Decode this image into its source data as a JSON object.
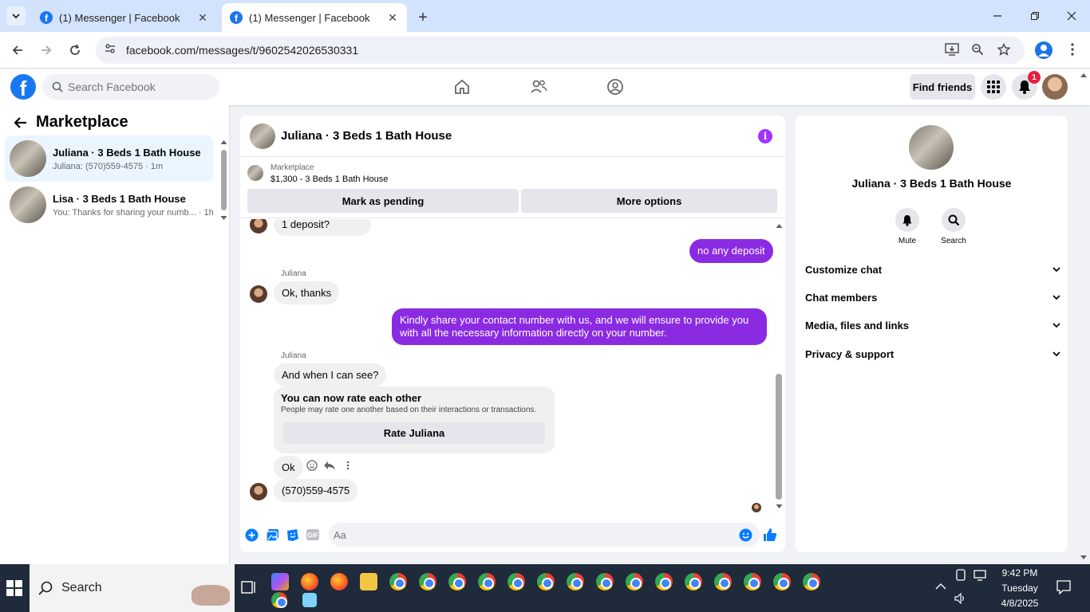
{
  "browser": {
    "tabs": [
      {
        "title": "(1) Messenger | Facebook",
        "active": false
      },
      {
        "title": "(1) Messenger | Facebook",
        "active": true
      }
    ],
    "url": "facebook.com/messages/t/9602542026530331"
  },
  "fb": {
    "logo": "f",
    "search_placeholder": "Search Facebook",
    "find_friends": "Find friends",
    "notification_count": "1"
  },
  "sidebar": {
    "title": "Marketplace",
    "conversations": [
      {
        "name": "Juliana · 3 Beds 1 Bath House",
        "preview": "Juliana: (570)559-4575 · 1m"
      },
      {
        "name": "Lisa · 3 Beds 1 Bath House",
        "preview": "You: Thanks for sharing your numb... · 1h"
      }
    ]
  },
  "chat": {
    "title": "Juliana · 3 Beds 1 Bath House",
    "info_glyph": "i",
    "marketplace": {
      "label": "Marketplace",
      "listing": "$1,300 - 3 Beds 1 Bath House",
      "mark_pending": "Mark as pending",
      "more_options": "More options"
    },
    "messages": {
      "m1": "1 deposit?",
      "m2": "no any deposit",
      "sender1": "Juliana",
      "m3": "Ok, thanks",
      "m4": "Kindly share your contact number with us, and we will ensure to provide you with all the necessary information directly on your number.",
      "sender2": "Juliana",
      "m5": "And when I can see?",
      "m6": "Ok",
      "m7": "(570)559-4575"
    },
    "rate_card": {
      "title": "You can now rate each other",
      "subtitle": "People may rate one another based on their interactions or transactions.",
      "button": "Rate Juliana"
    },
    "composer_placeholder": "Aa"
  },
  "details": {
    "name": "Juliana · 3 Beds 1 Bath House",
    "actions": [
      {
        "label": "Mute"
      },
      {
        "label": "Search"
      }
    ],
    "sections": [
      "Customize chat",
      "Chat members",
      "Media, files and links",
      "Privacy & support"
    ]
  },
  "taskbar": {
    "search": "Search",
    "time": "9:42 PM",
    "day": "Tuesday",
    "date": "4/8/2025"
  },
  "colors": {
    "fb_blue": "#1877f2",
    "outgoing_bubble": "#8a2be2",
    "active_conversation": "#ebf5ff"
  }
}
